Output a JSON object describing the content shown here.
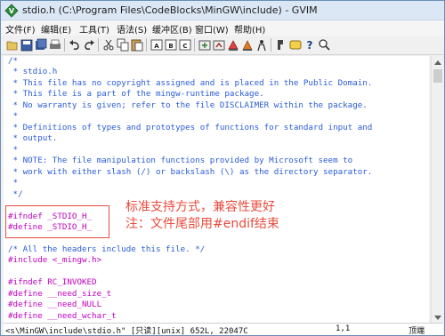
{
  "window": {
    "title": "stdio.h (C:\\Program Files\\CodeBlocks\\MinGW\\include) - GVIM"
  },
  "menu": [
    {
      "label": "文件(F)"
    },
    {
      "label": "编辑(E)"
    },
    {
      "label": "工具(T)"
    },
    {
      "label": "语法(S)"
    },
    {
      "label": "缓冲区(B)"
    },
    {
      "label": "窗口(W)"
    },
    {
      "label": "帮助(H)"
    }
  ],
  "toolbar": {
    "icons": [
      "open-icon",
      "save-icon",
      "save-all-icon",
      "print-icon",
      "undo-icon",
      "redo-icon",
      "cut-icon",
      "copy-icon",
      "paste-icon",
      "find-replace-icon",
      "find-next-icon",
      "find-prev-icon",
      "load-session-icon",
      "save-session-icon",
      "run-script-icon",
      "make-icon",
      "shell-icon",
      "tag-jump-icon",
      "tag-back-icon",
      "help-icon",
      "find-help-icon"
    ]
  },
  "editor": {
    "lines": [
      {
        "text": "/*",
        "kind": "comment"
      },
      {
        "text": " * stdio.h",
        "kind": "comment"
      },
      {
        "text": " * This file has no copyright assigned and is placed in the Public Domain.",
        "kind": "comment"
      },
      {
        "text": " * This file is a part of the mingw-runtime package.",
        "kind": "comment"
      },
      {
        "text": " * No warranty is given; refer to the file DISCLAIMER within the package.",
        "kind": "comment"
      },
      {
        "text": " *",
        "kind": "comment"
      },
      {
        "text": " * Definitions of types and prototypes of functions for standard input and",
        "kind": "comment"
      },
      {
        "text": " * output.",
        "kind": "comment"
      },
      {
        "text": " *",
        "kind": "comment"
      },
      {
        "text": " * NOTE: The file manipulation functions provided by Microsoft seem to",
        "kind": "comment"
      },
      {
        "text": " * work with either slash (/) or backslash (\\) as the directory separator.",
        "kind": "comment"
      },
      {
        "text": " *",
        "kind": "comment"
      },
      {
        "text": " */",
        "kind": "comment"
      },
      {
        "text": "",
        "kind": "blank"
      },
      {
        "text": "#ifndef _STDIO_H_",
        "kind": "pre"
      },
      {
        "text": "#define _STDIO_H_",
        "kind": "pre"
      },
      {
        "text": "",
        "kind": "blank"
      },
      {
        "text": "/* All the headers include this file. */",
        "kind": "comment"
      },
      {
        "text": "#include <_mingw.h>",
        "kind": "include"
      },
      {
        "text": "",
        "kind": "blank"
      },
      {
        "text": "#ifndef RC_INVOKED",
        "kind": "pre"
      },
      {
        "text": "#define __need_size_t",
        "kind": "pre"
      },
      {
        "text": "#define __need_NULL",
        "kind": "pre"
      },
      {
        "text": "#define __need_wchar_t",
        "kind": "pre"
      }
    ]
  },
  "annotation": {
    "line1": "标准支持方式，兼容性更好",
    "line2": "注：文件尾部用#endif结束",
    "color": "#e84c3d"
  },
  "status": {
    "file_info": "<s\\MinGW\\include\\stdio.h\" [只读][unix] 652L, 22047C",
    "position": "1,1",
    "scroll": "顶端"
  },
  "colors": {
    "comment": "#2a5bd7",
    "preprocessor": "#c000c0"
  }
}
